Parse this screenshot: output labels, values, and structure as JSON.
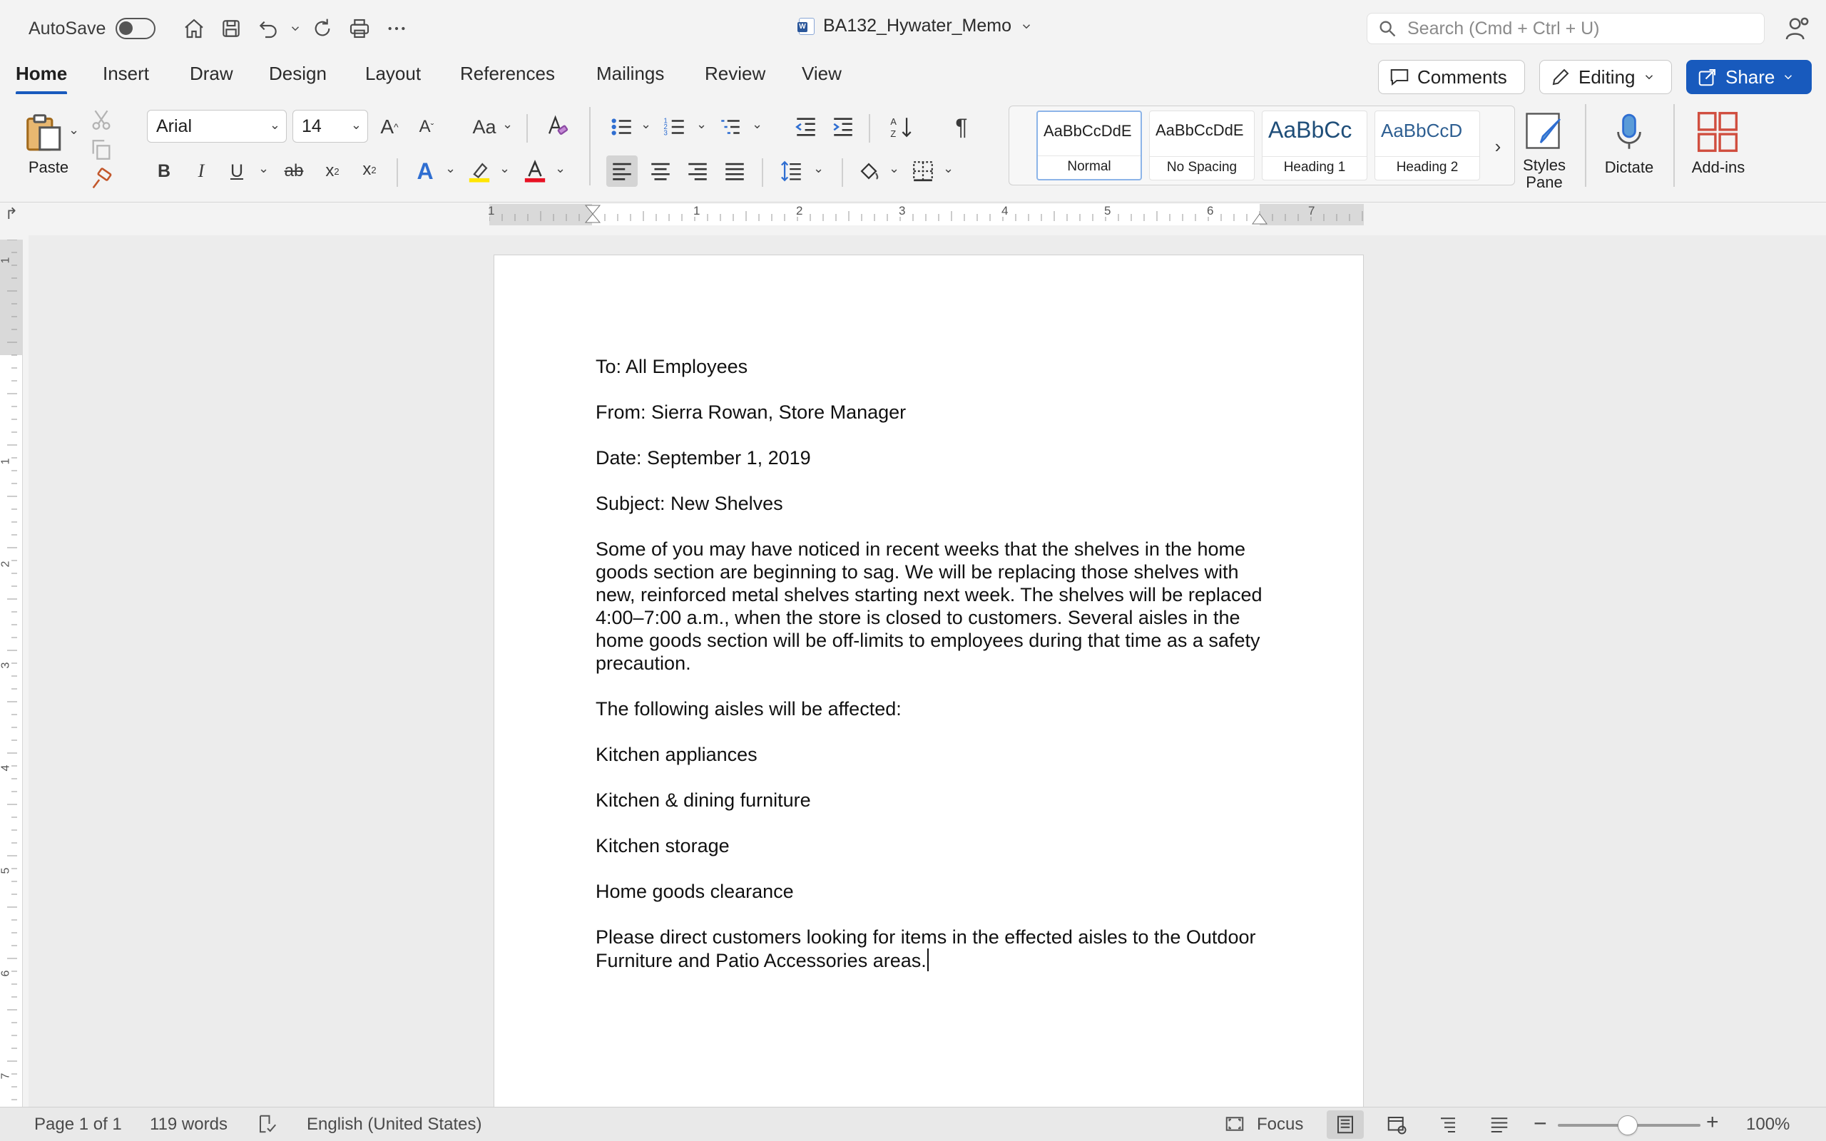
{
  "titlebar": {
    "autosave_label": "AutoSave",
    "document_title": "BA132_Hywater_Memo",
    "search_placeholder": "Search (Cmd + Ctrl + U)"
  },
  "tabs": [
    "Home",
    "Insert",
    "Draw",
    "Design",
    "Layout",
    "References",
    "Mailings",
    "Review",
    "View"
  ],
  "ribbon_buttons": {
    "comments": "Comments",
    "editing": "Editing",
    "share": "Share"
  },
  "ribbon": {
    "paste_label": "Paste",
    "font_name": "Arial",
    "font_size": "14",
    "change_case_label": "Aa",
    "styles": [
      {
        "sample": "AaBbCcDdE",
        "name": "Normal"
      },
      {
        "sample": "AaBbCcDdE",
        "name": "No Spacing"
      },
      {
        "sample": "AaBbCc",
        "name": "Heading 1"
      },
      {
        "sample": "AaBbCcD",
        "name": "Heading 2"
      }
    ],
    "styles_pane_label": "Styles\nPane",
    "dictate_label": "Dictate",
    "addins_label": "Add-ins"
  },
  "ruler": {
    "h_numbers": [
      "1",
      "1",
      "2",
      "3",
      "4",
      "5",
      "6",
      "7"
    ],
    "v_numbers": [
      "1",
      "1",
      "2",
      "3",
      "4",
      "5",
      "6",
      "7"
    ]
  },
  "document": {
    "to": "To: All Employees",
    "from": "From: Sierra Rowan, Store Manager",
    "date": "Date: September 1, 2019",
    "subject": "Subject: New Shelves",
    "body1": "Some of you may have noticed in recent weeks that the shelves in the home goods section are beginning to sag. We will be replacing those shelves with new, reinforced metal shelves starting next week. The shelves will be replaced 4:00–7:00 a.m., when the store is closed to customers. Several aisles in the home goods section will be off-limits to employees during that time as a safety precaution.",
    "body2": "The following aisles will be affected:",
    "aisles": [
      "Kitchen appliances",
      "Kitchen & dining furniture",
      "Kitchen storage",
      "Home goods clearance"
    ],
    "body3": "Please direct customers looking for items in the effected aisles to the Outdoor Furniture and Patio Accessories areas."
  },
  "status": {
    "page": "Page 1 of 1",
    "words": "119 words",
    "language": "English (United States)",
    "focus": "Focus",
    "zoom": "100%"
  },
  "colors": {
    "accent": "#185abd",
    "highlight": "#ffe500",
    "font_color": "#e81123",
    "addins": "#d04e3f"
  }
}
